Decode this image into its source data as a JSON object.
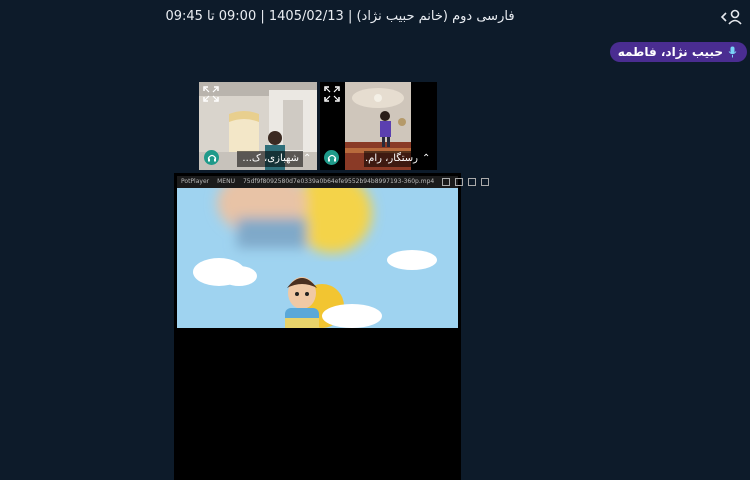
{
  "header": {
    "title": "فارسی دوم (خانم حبیب نژاد) | 1405/02/13 | 09:00 تا 09:45"
  },
  "active_speaker": {
    "name": "حبیب نژاد، فاطمه",
    "icon": "mic-icon",
    "color": "#4a2d91"
  },
  "participants": [
    {
      "name": "شهبازی، ک...",
      "audio_icon": "headset-icon"
    },
    {
      "name": "رستگار، رام...",
      "audio_icon": "headset-icon"
    }
  ],
  "screen_share": {
    "app_name": "PotPlayer",
    "menu_label": "MENU",
    "file_name": "75df9f8092580d7e0339a0b64efe9552b94b8997193-360p.mp4"
  },
  "colors": {
    "background": "#0d1b2a",
    "accent": "#4a2d91",
    "audio_badge": "#1f9a8a"
  }
}
